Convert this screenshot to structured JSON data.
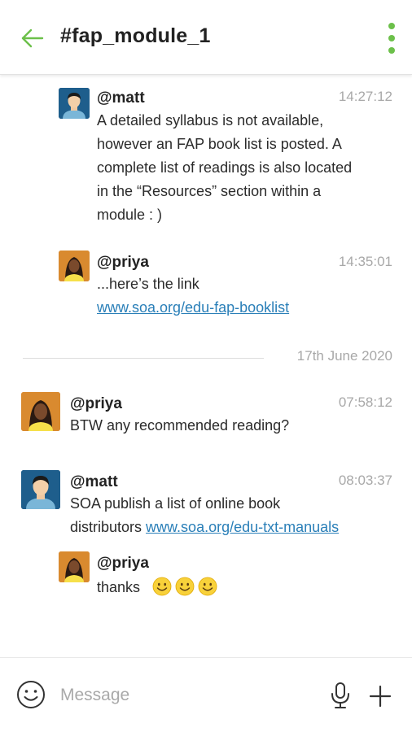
{
  "header": {
    "title": "#fap_module_1",
    "back_icon": "arrow-left-icon",
    "menu_icon": "more-vertical-icon",
    "accent_color": "#6cc04a"
  },
  "messages": [
    {
      "user": "@matt",
      "time": "14:27:12",
      "lines": [
        "A detailed syllabus is not available,",
        "however an FAP book list is posted. A",
        "complete list of readings is also located",
        "in the “Resources” section within a",
        "module : )"
      ]
    },
    {
      "user": "@priya",
      "time": "14:35:01",
      "text": "...here’s the link",
      "link": "www.soa.org/edu-fap-booklist"
    },
    {
      "user": "@priya",
      "time": "07:58:12",
      "text": "BTW any recommended reading?"
    },
    {
      "user": "@matt",
      "time": "08:03:37",
      "text_line1": "SOA publish a list of online book",
      "text_prefix": "distributors ",
      "link": "www.soa.org/edu-txt-manuals"
    },
    {
      "user": "@priya",
      "text": "thanks",
      "emoji": [
        "smiling-face-icon",
        "smiling-face-icon",
        "smiling-face-icon"
      ]
    }
  ],
  "date_separator": "17th June 2020",
  "composer": {
    "placeholder": "Message",
    "emoji_icon": "smiley-icon",
    "mic_icon": "microphone-icon",
    "add_icon": "plus-icon"
  },
  "colors": {
    "link": "#2a7fb8",
    "timestamp": "#a8a8a8",
    "matt_avatar_bg": "#1e5e8c",
    "priya_avatar_bg": "#d98a2f"
  }
}
